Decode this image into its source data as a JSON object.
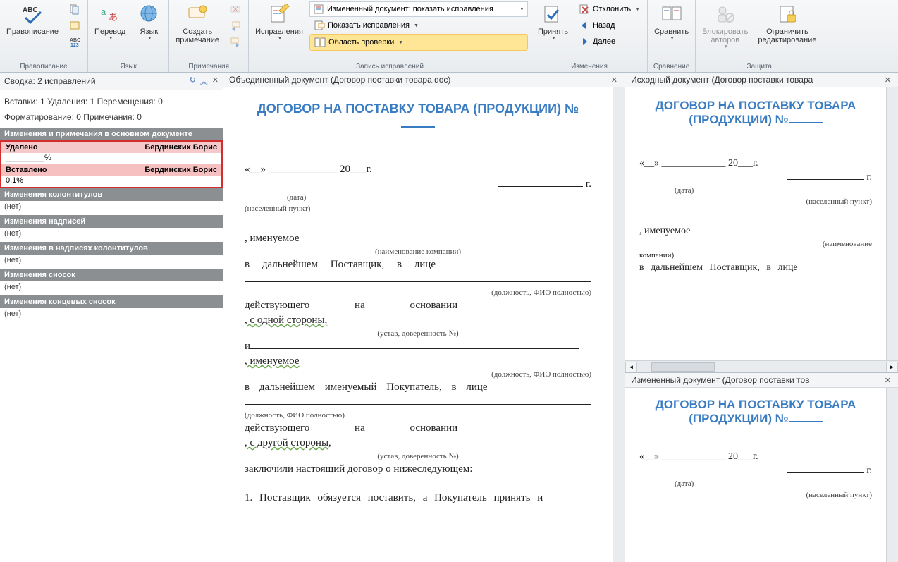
{
  "ribbon": {
    "groups": {
      "proofing": {
        "title": "Правописание",
        "spelling": "Правописание"
      },
      "language": {
        "title": "Язык",
        "translate": "Перевод",
        "language": "Язык"
      },
      "comments": {
        "title": "Примечания",
        "new_comment": "Создать\nпримечание"
      },
      "tracking": {
        "title": "Запись исправлений",
        "track": "Исправления",
        "combo": "Измененный документ: показать исправления",
        "show_markup": "Показать исправления",
        "reviewing_pane": "Область проверки"
      },
      "changes": {
        "title": "Изменения",
        "accept": "Принять",
        "reject": "Отклонить",
        "back": "Назад",
        "next": "Далее"
      },
      "compare": {
        "title": "Сравнение",
        "compare": "Сравнить"
      },
      "protect": {
        "title": "Защита",
        "block_authors": "Блокировать\nавторов",
        "restrict": "Ограничить\nредактирование"
      }
    }
  },
  "summary": {
    "title": "Сводка: 2 исправлений",
    "stats_line1": "Вставки: 1 Удаления: 1 Перемещения: 0",
    "stats_line2": "Форматирование: 0 Примечания: 0",
    "sec_main": "Изменения и примечания в основном документе",
    "deleted_label": "Удалено",
    "author": "Бердинских Борис",
    "deleted_detail": "_________%",
    "inserted_label": "Вставлено",
    "inserted_detail": "0,1%",
    "sec_headers": "Изменения колонтитулов",
    "sec_textboxes": "Изменения надписей",
    "sec_hf_textboxes": "Изменения в надписях колонтитулов",
    "sec_footnotes": "Изменения сносок",
    "sec_endnotes": "Изменения концевых сносок",
    "none": "(нет)"
  },
  "docs": {
    "merged_title": "Объединенный документ (Договор поставки товара.doc)",
    "source_title": "Исходный документ (Договор поставки товара",
    "revised_title": "Измененный документ (Договор поставки тов"
  },
  "page": {
    "title": "ДОГОВОР НА ПОСТАВКУ ТОВАРА (ПРОДУКЦИИ) №",
    "date_row": "«__» _____________ 20___г.",
    "g_suffix": "г.",
    "date_caption": "(дата)",
    "place_caption": "(населенный пункт)",
    "named": ", именуемое",
    "company_caption": "(наименование компании)",
    "supplier_line": "в дальнейшем Поставщик, в лице",
    "fio_caption": "(должность, ФИО полностью)",
    "acting_on": "действующего на основании",
    "side1": ", с одной стороны,",
    "charter_caption": "(устав, доверенность №)",
    "and": "и",
    "buyer_line": "в дальнейшем именуемый Покупатель, в лице",
    "fio_caption2": "(должность, ФИО полностью)",
    "side2": ", с другой стороны,",
    "concluded": "заключили настоящий договор о нижеследующем:",
    "p1": "1. Поставщик обязуется поставить, а Покупатель принять и"
  }
}
